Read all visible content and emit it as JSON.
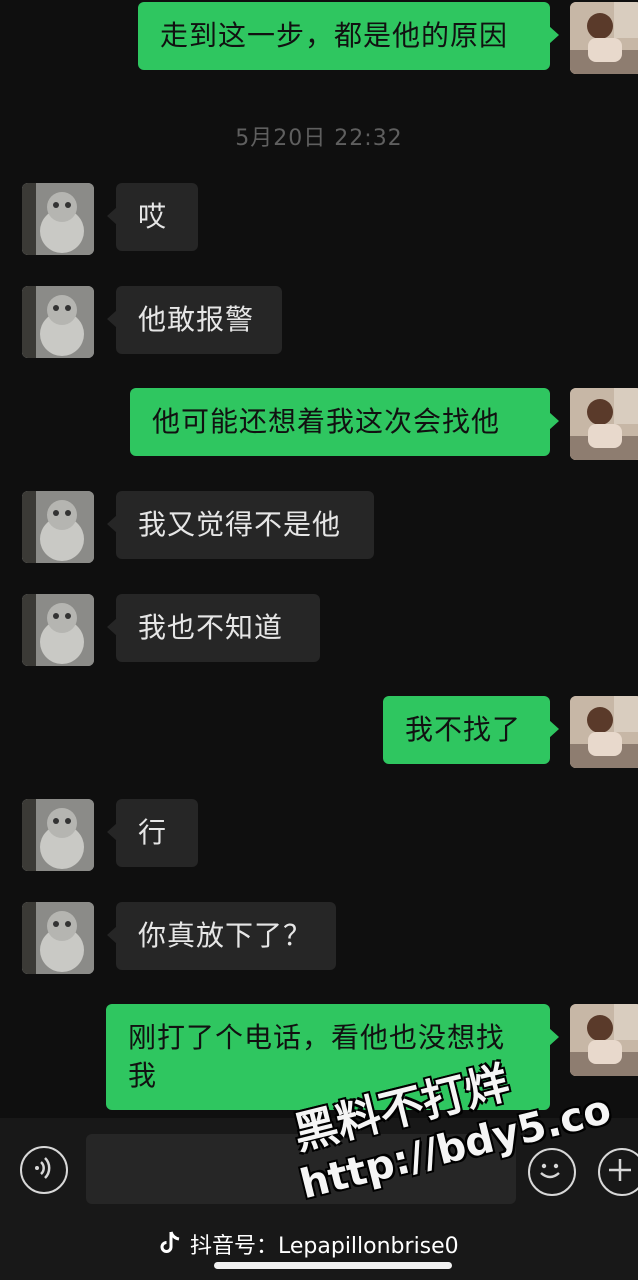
{
  "messages": [
    {
      "side": "sent",
      "text": "走到这一步，都是他的原因"
    },
    {
      "side": "recv",
      "text": "哎"
    },
    {
      "side": "recv",
      "text": "他敢报警"
    },
    {
      "side": "sent",
      "text": "他可能还想着我这次会找他"
    },
    {
      "side": "recv",
      "text": "我又觉得不是他"
    },
    {
      "side": "recv",
      "text": "我也不知道"
    },
    {
      "side": "sent",
      "text": "我不找了"
    },
    {
      "side": "recv",
      "text": "行"
    },
    {
      "side": "recv",
      "text": "你真放下了？"
    },
    {
      "side": "sent",
      "text": "刚打了个电话，看他也没想找我"
    }
  ],
  "timestamp": "5月20日 22:32",
  "footer": {
    "platform_account": "抖音号：Lepapillonbrise0"
  },
  "watermark": {
    "line1": "黑料不打烊",
    "line2": "http://bdy5.co"
  },
  "colors": {
    "sent_bubble": "#2fc660",
    "recv_bubble": "#262626",
    "background": "#0f0f0f"
  },
  "icons": {
    "voice": "voice-icon",
    "emoji": "emoji-icon",
    "plus": "plus-icon",
    "tiktok": "tiktok-logo-icon"
  }
}
